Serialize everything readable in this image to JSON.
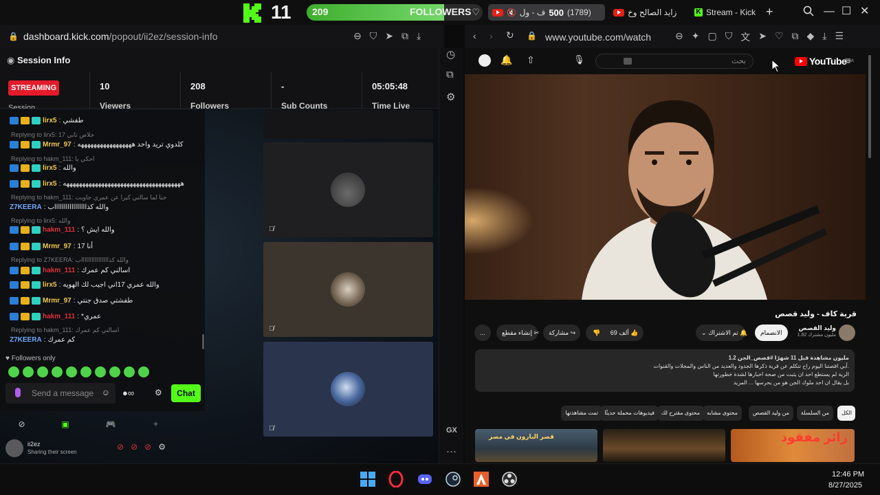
{
  "overlay": {
    "viewers": "11",
    "followers_count": "209",
    "followers_label": "FOLLOWERS",
    "followers_progress": 0.78
  },
  "tabs": [
    {
      "label": "ف - ول",
      "count": "500",
      "sub": "(1789)"
    },
    {
      "label": "زايد الصالح وخ"
    },
    {
      "label": "Stream - Kick"
    }
  ],
  "left_browser": {
    "url_host": "dashboard.kick.com",
    "url_path": "/popout/ii2ez/session-info"
  },
  "session": {
    "title": "Session Info",
    "status_badge": "STREAMING",
    "session_label": "Session",
    "stats": [
      {
        "value": "10",
        "label": "Viewers"
      },
      {
        "value": "208",
        "label": "Followers"
      },
      {
        "value": "-",
        "label": "Sub Counts"
      },
      {
        "value": "05:05:48",
        "label": "Time Live"
      }
    ]
  },
  "chat": {
    "lines": [
      {
        "type": "msg",
        "user": "lirx5",
        "user_color": "#f2c94c",
        "text": "طفشي"
      },
      {
        "type": "reply",
        "text": "Replying to lirx5: 17 خلاص تاني"
      },
      {
        "type": "msg",
        "user": "Mrmr_97",
        "user_color": "#f2c94c",
        "text": "كلدوي تريد واحد هههههههههههههههههه"
      },
      {
        "type": "reply",
        "text": "Replying to hakm_111: احكي يا"
      },
      {
        "type": "msg",
        "user": "lirx5",
        "user_color": "#f2c94c",
        "text": "والله"
      },
      {
        "type": "msg",
        "user": "lirx5",
        "user_color": "#f2c94c",
        "text": "هههههههههههههههههههههههههههههههههههههه"
      },
      {
        "type": "reply",
        "text": "Replying to hakm_111: حنا لما سالني كيرا عن عمري جاوبت"
      },
      {
        "type": "msg_plain",
        "user": "Z7KEERA",
        "user_color": "#6fa8ff",
        "text": "والله كذاااااااااااااااااب"
      },
      {
        "type": "reply",
        "text": "Replying to lirx5: والله"
      },
      {
        "type": "msg",
        "user": "hakm_111",
        "user_color": "#e0303a",
        "text": "والله ايش ؟"
      },
      {
        "type": "msg",
        "user": "Mrmr_97",
        "user_color": "#f2c94c",
        "text": "17 أنا"
      },
      {
        "type": "reply",
        "text": "Replying to Z7KEERA: والله كذااااااااااااااااب"
      },
      {
        "type": "msg",
        "user": "hakm_111",
        "user_color": "#e0303a",
        "text": "اسالني كم عمرك"
      },
      {
        "type": "msg",
        "user": "lirx5",
        "user_color": "#f2c94c",
        "text": "والله عمري 17اني اجيب لك الهويه"
      },
      {
        "type": "msg",
        "user": "Mrmr_97",
        "user_color": "#f2c94c",
        "text": "طفشتي صدق جنتي"
      },
      {
        "type": "msg",
        "user": "hakm_111",
        "user_color": "#e0303a",
        "text": "*عمري"
      },
      {
        "type": "reply",
        "text": "Replying to hakm_111: اسالني كم عمرك"
      },
      {
        "type": "msg_plain",
        "user": "Z7KEERA",
        "user_color": "#6fa8ff",
        "text": "كم عمرك"
      }
    ],
    "followers_only": "Followers only",
    "input_placeholder": "Send a message",
    "send_label": "Chat"
  },
  "streamer": {
    "name": "ii2ez",
    "status": "Sharing their screen"
  },
  "right_browser": {
    "url": "www.youtube.com/watch"
  },
  "youtube": {
    "logo": "YouTube",
    "logo_region": "SA",
    "search_placeholder": "بحث",
    "title": "قرية كاف - وليد قصص",
    "channel_name": "وليد القصص",
    "subscribers": "1.82 مليون مشترك",
    "join_label": "الانضمام",
    "subscribed_label": "تم الاشتراك",
    "likes": "69 ألف",
    "share_label": "مشاركة",
    "clip_label": "إنشاء مقطع",
    "more": "...",
    "description": [
      "1.2 مليون مشاهدة قبل 11 شهرًا #قصص_الجن",
      "أبي اقصتنا اليوم راح نتكلم عن قرية ذكرها الجدود والعديد من الناس والمجلات والقنوات.",
      "الرية لم يستطع احد ان يثبت من صحة اخبارها لشدة خطورتها",
      "بل يقال ان احد ملوك الجن هو من يحرسها ... المزيد"
    ],
    "chips": [
      "الكل",
      "من السلسلة",
      "من وليد القصص",
      "محتوى مشابه",
      "محتوى مقترح لك",
      "فيديوهات محملة حديثًا",
      "تمت مشاهدتها"
    ],
    "thumbnails": [
      {
        "title": "قصر البارون في مصر"
      },
      {
        "title": ""
      },
      {
        "title": ""
      },
      {
        "title": "زائر مفقود"
      }
    ]
  },
  "taskbar": {
    "time": "12:46 PM",
    "date": "8/27/2025"
  },
  "colors": {
    "kick_green": "#53fc18",
    "streaming_red": "#e31b2b",
    "youtube_red": "#ff0000"
  }
}
